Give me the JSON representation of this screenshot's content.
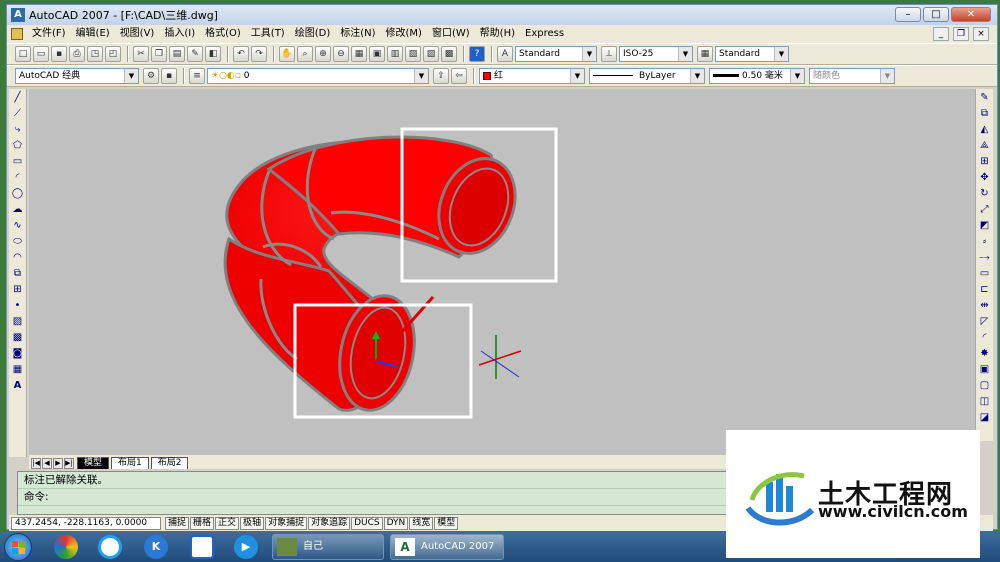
{
  "window": {
    "title": "AutoCAD 2007 - [F:\\CAD\\三维.dwg]"
  },
  "menu": [
    "文件(F)",
    "编辑(E)",
    "视图(V)",
    "插入(I)",
    "格式(O)",
    "工具(T)",
    "绘图(D)",
    "标注(N)",
    "修改(M)",
    "窗口(W)",
    "帮助(H)",
    "Express"
  ],
  "toolbar1": {
    "text_style": "Standard",
    "dim_style": "ISO-25",
    "table_style": "Standard"
  },
  "toolbar2": {
    "workspace": "AutoCAD 经典",
    "layer": "0",
    "color": "红",
    "linetype": "ByLayer",
    "lineweight": "0.50 毫米",
    "plot_style": "随颜色"
  },
  "tabs": {
    "model": "模型",
    "layout1": "布局1",
    "layout2": "布局2"
  },
  "command": {
    "history": "标注已解除关联。",
    "prompt": "命令:"
  },
  "status": {
    "coords": "437.2454, -228.1163, 0.0000",
    "buttons": [
      "捕捉",
      "栅格",
      "正交",
      "极轴",
      "对象捕捉",
      "对象追踪",
      "DUCS",
      "DYN",
      "线宽",
      "模型"
    ]
  },
  "taskbar": {
    "task1": "自己",
    "task2": "AutoCAD 2007 -..."
  },
  "watermark": {
    "name": "土木工程网",
    "url": "www.civilcn.com"
  },
  "colors": {
    "model_space_bg": "#c0c0c0",
    "torus_red": "#ff0000",
    "highlight_box": "#ffffff"
  }
}
